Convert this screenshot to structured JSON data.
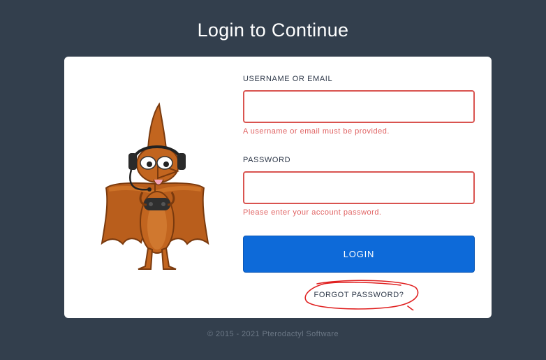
{
  "page": {
    "title": "Login to Continue",
    "footer": "© 2015 - 2021 Pterodactyl Software"
  },
  "form": {
    "username_label": "USERNAME OR EMAIL",
    "username_value": "",
    "username_error": "A username or email must be provided.",
    "password_label": "PASSWORD",
    "password_value": "",
    "password_error": "Please enter your account password.",
    "login_label": "LOGIN",
    "forgot_label": "FORGOT PASSWORD?"
  },
  "mascot": {
    "icon": "pterodactyl-mascot-icon"
  },
  "colors": {
    "background": "#333f4d",
    "card": "#ffffff",
    "error": "#d9534f",
    "primary": "#0d6ad9",
    "annotation": "#e02020"
  }
}
